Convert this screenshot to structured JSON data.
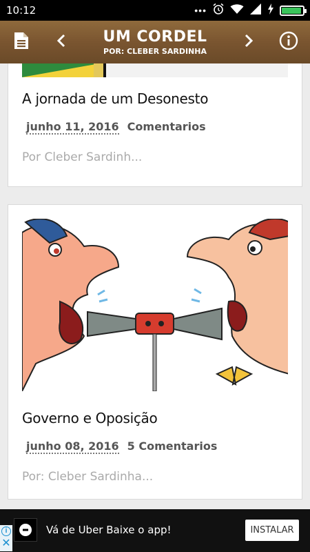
{
  "status_bar": {
    "time": "10:12",
    "dots": "•••"
  },
  "app_bar": {
    "title": "UM CORDEL",
    "subtitle": "POR: CLEBER SARDINHA"
  },
  "posts": [
    {
      "title": "A jornada de um Desonesto",
      "date": "junho 11, 2016",
      "comments": "Comentarios",
      "author": "Por Cleber Sardinh..."
    },
    {
      "title": "Governo e Oposição",
      "date": "junho 08, 2016",
      "comments": "5 Comentarios",
      "author": "Por: Cleber Sardinha..."
    }
  ],
  "ad": {
    "text": "Vá de Uber Baixe o app!",
    "button": "INSTALAR"
  }
}
